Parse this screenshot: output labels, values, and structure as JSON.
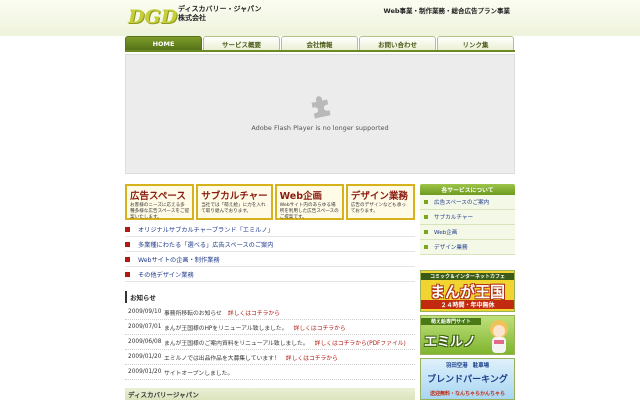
{
  "header": {
    "logo_text": "DGD",
    "company_line1": "ディスカバリー・ジャパン",
    "company_line2": "株式会社",
    "tagline": "Web事業・制作業務・総合広告プラン事業"
  },
  "nav": {
    "tabs": [
      {
        "label": "HOME",
        "active": true
      },
      {
        "label": "サービス概要"
      },
      {
        "label": "会社情報"
      },
      {
        "label": "お問い合わせ"
      },
      {
        "label": "リンク集"
      }
    ]
  },
  "flash": {
    "icon": "plugin-icon",
    "message": "Adobe Flash Player is no longer supported"
  },
  "cards": [
    {
      "title": "広告スペース",
      "desc": "お客様のニーズに応える多種多様な広告スペースをご提案いたします。"
    },
    {
      "title": "サブカルチャー",
      "desc": "当社では「萌え絵」に力を入れて取り組んでおります。"
    },
    {
      "title": "Web企画",
      "desc": "Webサイト内のあらゆる場所を利用した広告スペースのご提案です。"
    },
    {
      "title": "デザイン業務",
      "desc": "広告のデザインなども承っております。"
    }
  ],
  "links": [
    "オリジナルサブカルチャーブランド「エミルノ」",
    "多業種にわたる「選べる」広告スペースのご案内",
    "Webサイトの企画・制作業務",
    "その他デザイン業務"
  ],
  "news": {
    "heading": "お知らせ",
    "items": [
      {
        "date": "2009/09/10",
        "text": "事務所移転のお知らせ",
        "link": "詳しくはコチラから"
      },
      {
        "date": "2009/07/01",
        "text": "まんが王国様のHPをリニューアル致しました。",
        "link": "詳しくはコチラから"
      },
      {
        "date": "2009/06/08",
        "text": "まんが王国様のご案内資料をリニューアル致しました。",
        "link": "詳しくはコチラから(PDFファイル)"
      },
      {
        "date": "2009/01/20",
        "text": "エミルノでは出品作品を大募集しています！",
        "link": "詳しくはコチラから"
      },
      {
        "date": "2009/01/20",
        "text": "サイトオープンしました。",
        "link": ""
      }
    ]
  },
  "footer": {
    "label": "ディスカバリージャパン"
  },
  "sidebar": {
    "heading": "各サービスについて",
    "items": [
      "広告スペースのご案内",
      "サブカルチャー",
      "Web企画",
      "デザイン業務"
    ]
  },
  "banners": {
    "manga": {
      "top": "コミック＆インターネットカフェ",
      "main": "まんが王国",
      "sub": "２４時間・年中無休"
    },
    "emiruno": {
      "top": "萌え絵専門サイト",
      "main": "エミルノ"
    },
    "parking": {
      "top": "羽田空港　駐車場",
      "main": "ブレンドパーキング",
      "sub": "送迎無料・なんちゃらかんちゃら"
    }
  }
}
